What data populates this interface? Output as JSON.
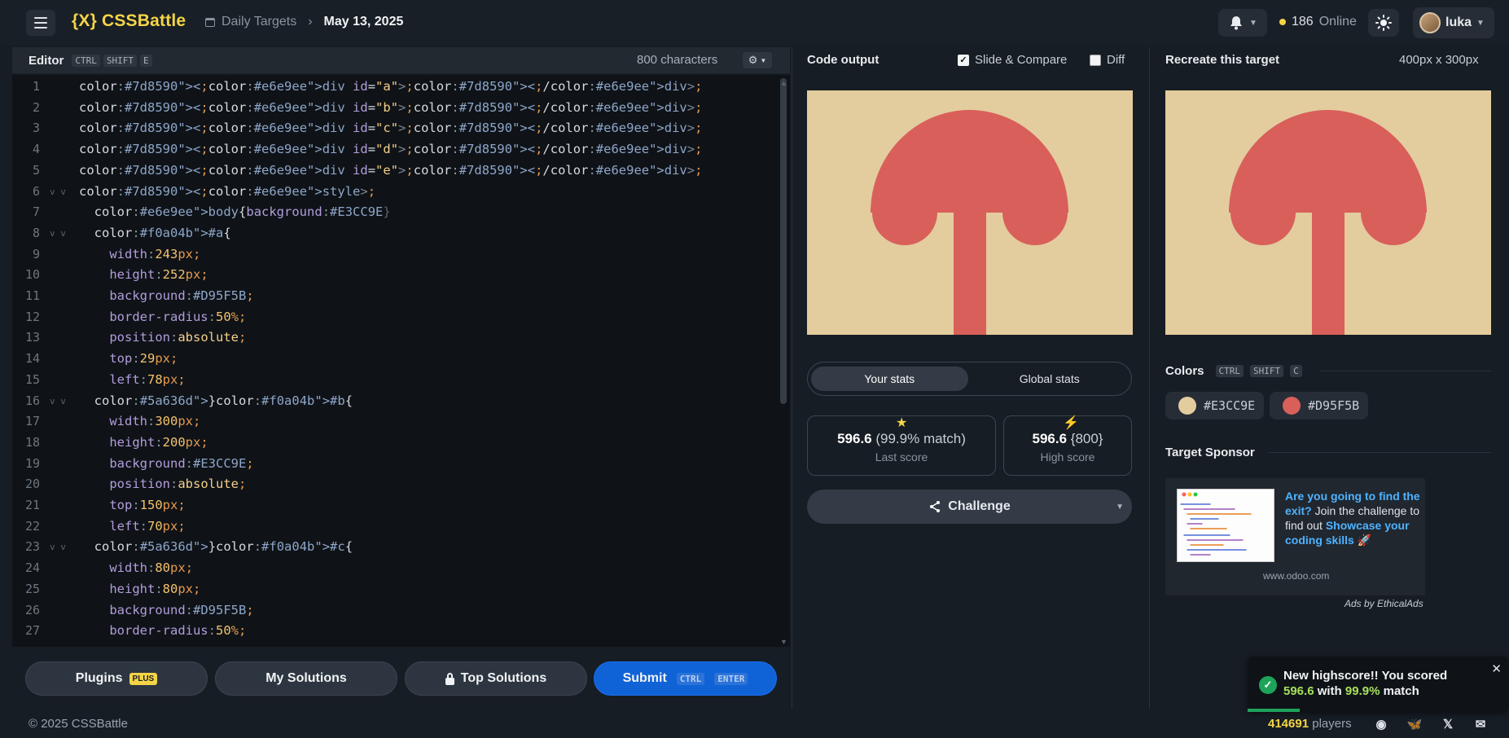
{
  "header": {
    "logo": "{X} CSSBattle",
    "crumb_parent": "Daily Targets",
    "crumb_current": "May 13, 2025",
    "online_count": "186",
    "online_label": "Online",
    "username": "luka"
  },
  "editor": {
    "title": "Editor",
    "keys": [
      "CTRL",
      "SHIFT",
      "E"
    ],
    "char_count": "800 characters",
    "lines": [
      {
        "n": "1",
        "fold": "",
        "t": "<div id=\"a\"></div>"
      },
      {
        "n": "2",
        "fold": "",
        "t": "<div id=\"b\"></div>"
      },
      {
        "n": "3",
        "fold": "",
        "t": "<div id=\"c\"></div>"
      },
      {
        "n": "4",
        "fold": "",
        "t": "<div id=\"d\"></div>"
      },
      {
        "n": "5",
        "fold": "",
        "t": "<div id=\"e\"></div>"
      },
      {
        "n": "6",
        "fold": "v v",
        "t": "<style>"
      },
      {
        "n": "7",
        "fold": "",
        "t": "  body{background:#E3CC9E}"
      },
      {
        "n": "8",
        "fold": "v v",
        "t": "  #a{"
      },
      {
        "n": "9",
        "fold": "",
        "t": "    width:243px;"
      },
      {
        "n": "10",
        "fold": "",
        "t": "    height:252px;"
      },
      {
        "n": "11",
        "fold": "",
        "t": "    background:#D95F5B;"
      },
      {
        "n": "12",
        "fold": "",
        "t": "    border-radius:50%;"
      },
      {
        "n": "13",
        "fold": "",
        "t": "    position:absolute;"
      },
      {
        "n": "14",
        "fold": "",
        "t": "    top:29px;"
      },
      {
        "n": "15",
        "fold": "",
        "t": "    left:78px;"
      },
      {
        "n": "16",
        "fold": "v v",
        "t": "  }#b{"
      },
      {
        "n": "17",
        "fold": "",
        "t": "    width:300px;"
      },
      {
        "n": "18",
        "fold": "",
        "t": "    height:200px;"
      },
      {
        "n": "19",
        "fold": "",
        "t": "    background:#E3CC9E;"
      },
      {
        "n": "20",
        "fold": "",
        "t": "    position:absolute;"
      },
      {
        "n": "21",
        "fold": "",
        "t": "    top:150px;"
      },
      {
        "n": "22",
        "fold": "",
        "t": "    left:70px;"
      },
      {
        "n": "23",
        "fold": "v v",
        "t": "  }#c{"
      },
      {
        "n": "24",
        "fold": "",
        "t": "    width:80px;"
      },
      {
        "n": "25",
        "fold": "",
        "t": "    height:80px;"
      },
      {
        "n": "26",
        "fold": "",
        "t": "    background:#D95F5B;"
      },
      {
        "n": "27",
        "fold": "",
        "t": "    border-radius:50%;"
      }
    ]
  },
  "footer_buttons": {
    "plugins": "Plugins",
    "plus_badge": "PLUS",
    "my_solutions": "My Solutions",
    "top_solutions": "Top Solutions",
    "submit": "Submit",
    "submit_keys": [
      "CTRL",
      "ENTER"
    ]
  },
  "copyright": "© 2025 CSSBattle",
  "output": {
    "title": "Code output",
    "slide_compare": "Slide & Compare",
    "diff": "Diff",
    "tabs": [
      "Your stats",
      "Global stats"
    ],
    "last_score": "596.6",
    "last_match": "(99.9% match)",
    "last_label": "Last score",
    "high_score": "596.6",
    "high_chars": "{800}",
    "high_label": "High score",
    "challenge": "Challenge"
  },
  "target": {
    "title": "Recreate this target",
    "size": "400px x 300px",
    "colors_title": "Colors",
    "colors_keys": [
      "CTRL",
      "SHIFT",
      "C"
    ],
    "colors": [
      {
        "hex": "#E3CC9E",
        "swatch": "#E3CC9E"
      },
      {
        "hex": "#D95F5B",
        "swatch": "#D95F5B"
      }
    ],
    "sponsor_title": "Target Sponsor",
    "ad_bold1": "Are you going to find the exit?",
    "ad_plain": " Join the challenge to find out ",
    "ad_bold2": "Showcase your coding skills",
    "ad_emoji": "🚀",
    "ad_url": "www.odoo.com",
    "ad_credit": "Ads by EthicalAds"
  },
  "toast": {
    "line1": "New highscore!! You scored",
    "score": "596.6",
    "with": "with",
    "match": "99.9%",
    "tail": "match"
  },
  "players": {
    "count": "414691",
    "label": "players"
  },
  "colors": {
    "accent": "#F5D547",
    "submit": "#1063D6",
    "bg": "#171D24",
    "editor_bg": "#0F1318",
    "target_bg": "#E3CC9E",
    "target_fg": "#D95F5B"
  }
}
